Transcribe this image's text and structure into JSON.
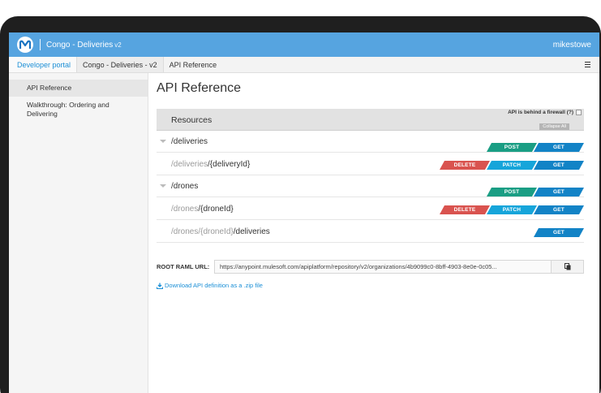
{
  "header": {
    "app_title": "Congo - Deliveries",
    "app_version": "v2",
    "user": "mikestowe"
  },
  "nav": {
    "portal": "Developer portal",
    "api": "Congo - Deliveries - v2",
    "current": "API Reference"
  },
  "sidebar": {
    "items": [
      {
        "label": "API Reference",
        "active": true
      },
      {
        "label": "Walkthrough: Ordering and Delivering",
        "active": false
      }
    ]
  },
  "main": {
    "title": "API Reference",
    "resources_label": "Resources",
    "firewall_label": "API is behind a firewall (?)",
    "collapse_label": "Collapse All",
    "resources": [
      {
        "prefix": "",
        "path": "/deliveries",
        "top": true,
        "methods": [
          "POST",
          "GET"
        ]
      },
      {
        "prefix": "/deliveries",
        "path": "/{deliveryId}",
        "top": false,
        "methods": [
          "DELETE",
          "PATCH",
          "GET"
        ]
      },
      {
        "prefix": "",
        "path": "/drones",
        "top": true,
        "methods": [
          "POST",
          "GET"
        ]
      },
      {
        "prefix": "/drones",
        "path": "/{droneId}",
        "top": false,
        "methods": [
          "DELETE",
          "PATCH",
          "GET"
        ]
      },
      {
        "prefix": "/drones/{droneId}",
        "path": "/deliveries",
        "top": false,
        "methods": [
          "GET"
        ]
      }
    ],
    "raml_label": "ROOT RAML URL:",
    "raml_url": "https://anypoint.mulesoft.com/apiplatform/repository/v2/organizations/4b9099c0-8bff-4903-8e0e-0c05...",
    "download_label": "Download API definition as a .zip file"
  },
  "colors": {
    "topbar": "#56a4e0",
    "post": "#1a9e84",
    "get": "#1283c6",
    "delete": "#d9534f",
    "patch": "#16a5da",
    "link": "#1b8fd6"
  },
  "icons": {
    "logo": "mulesoft-logo-icon",
    "menu": "hamburger-icon",
    "collapse": "caret-down-icon",
    "copy": "copy-icon",
    "download": "download-icon"
  }
}
